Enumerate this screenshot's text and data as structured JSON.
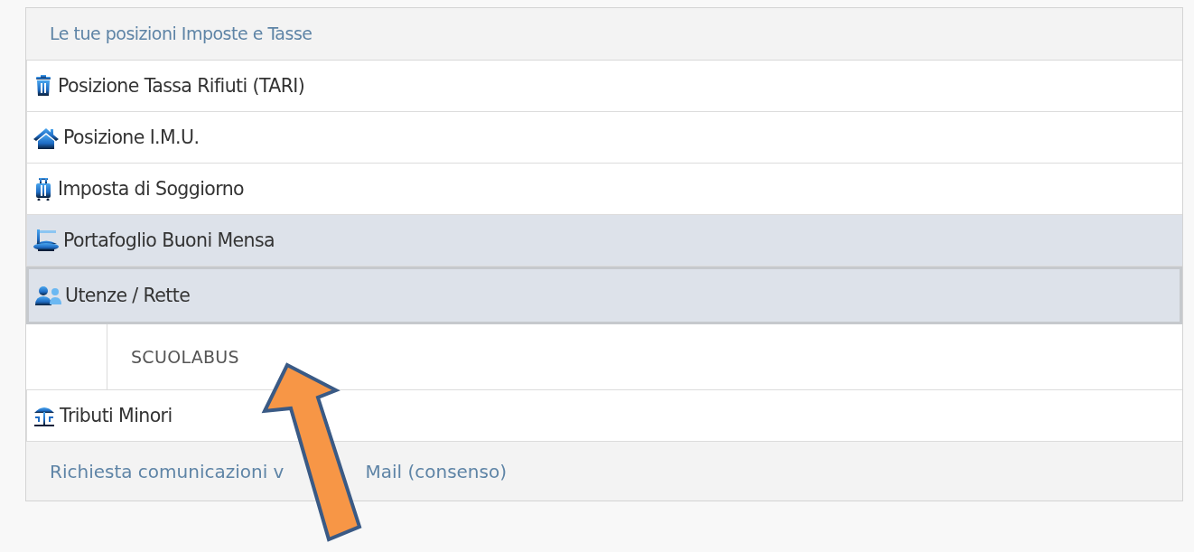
{
  "header": {
    "title": "Le tue posizioni Imposte e Tasse"
  },
  "items": [
    {
      "label": "Posizione Tassa Rifiuti (TARI)",
      "selected": false,
      "expanded": false
    },
    {
      "label": "Posizione I.M.U.",
      "selected": false,
      "expanded": false
    },
    {
      "label": "Imposta di Soggiorno",
      "selected": false,
      "expanded": false
    },
    {
      "label": "Portafoglio Buoni Mensa",
      "selected": true,
      "expanded": false
    },
    {
      "label": "Utenze / Rette",
      "selected": true,
      "expanded": true,
      "children": [
        {
          "label": "SCUOLABUS"
        }
      ]
    },
    {
      "label": "Tributi Minori",
      "selected": false,
      "expanded": false
    }
  ],
  "footer": {
    "parts": [
      "Richiesta comunicazioni v",
      "Mail (consenso)"
    ]
  },
  "annotation": {
    "kind": "arrow"
  }
}
